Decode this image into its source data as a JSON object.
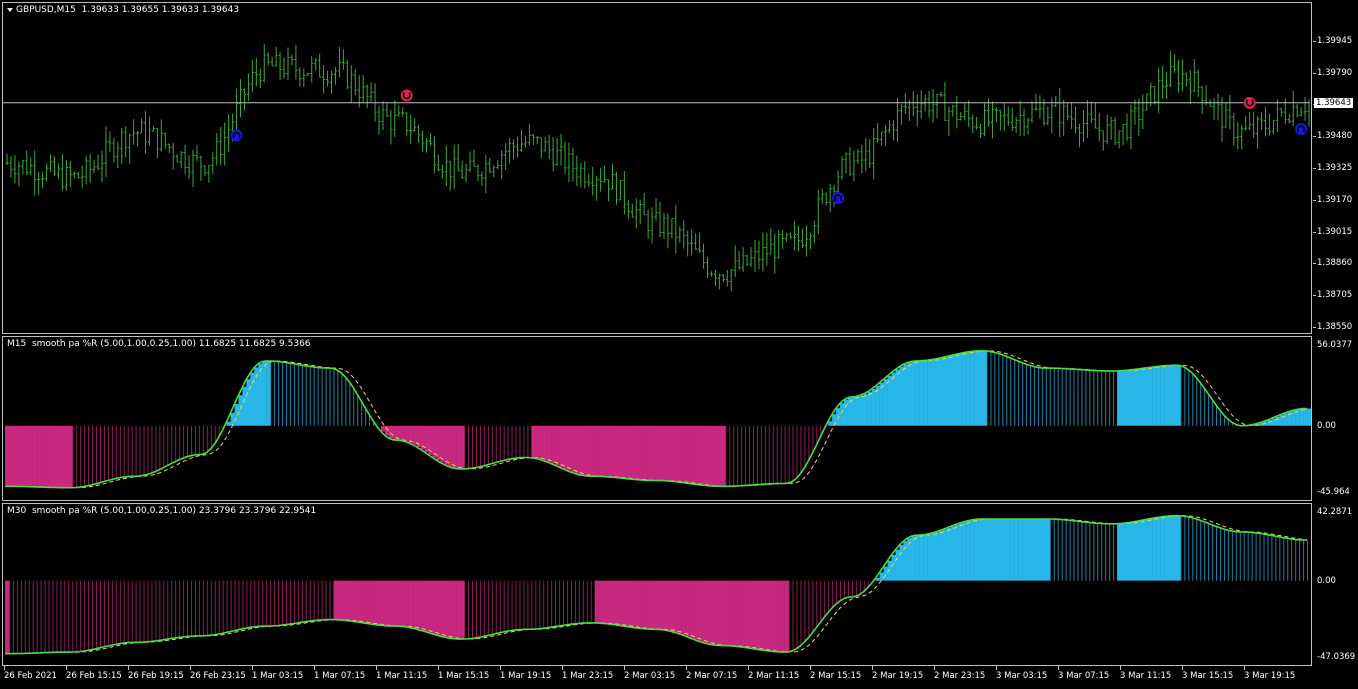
{
  "main": {
    "symbol": "GBPUSD,M15",
    "ohlc": "1.39633 1.39655 1.39633 1.39643",
    "price_labels": [
      "1.39945",
      "1.39790",
      "1.39635",
      "1.39480",
      "1.39325",
      "1.39170",
      "1.39015",
      "1.38860",
      "1.38705",
      "1.38550"
    ],
    "current_price": "1.39643",
    "colors": {
      "bars": "#3ea83e",
      "up_arrow": "#1616e6",
      "down_arrow": "#e0204a",
      "price_line": "#c0c0c0"
    }
  },
  "ind1": {
    "title": "M15  smooth pa %R (5.00,1.00,0.25,1.00) 11.6825 11.6825 9.5366",
    "scale": [
      "56.0377",
      "0.00",
      "-45.964"
    ],
    "colors": {
      "pos": "#29b6e8",
      "neg": "#c8287f",
      "line": "#46e046",
      "signal": "#e8e040"
    }
  },
  "ind2": {
    "title": "M30  smooth pa %R (5.00,1.00,0.25,1.00) 23.3796 23.3796 22.9541",
    "scale": [
      "42.2871",
      "0.00",
      "-47.0369"
    ],
    "colors": {
      "pos": "#29b6e8",
      "neg": "#c8287f",
      "line": "#46e046",
      "signal": "#e8e040"
    }
  },
  "time_axis": [
    "26 Feb 2021",
    "26 Feb 15:15",
    "26 Feb 19:15",
    "26 Feb 23:15",
    "1 Mar 03:15",
    "1 Mar 07:15",
    "1 Mar 11:15",
    "1 Mar 15:15",
    "1 Mar 19:15",
    "1 Mar 23:15",
    "2 Mar 03:15",
    "2 Mar 07:15",
    "2 Mar 11:15",
    "2 Mar 15:15",
    "2 Mar 19:15",
    "2 Mar 23:15",
    "3 Mar 03:15",
    "3 Mar 07:15",
    "3 Mar 11:15",
    "3 Mar 15:15",
    "3 Mar 19:15"
  ],
  "chart_data": [
    {
      "type": "line",
      "title": "GBPUSD,M15",
      "ylim": [
        1.3855,
        1.401
      ],
      "x": [
        "26 Feb 2021",
        "26 Feb 15:15",
        "26 Feb 19:15",
        "26 Feb 23:15",
        "1 Mar 03:15",
        "1 Mar 07:15",
        "1 Mar 11:15",
        "1 Mar 15:15",
        "1 Mar 19:15",
        "1 Mar 23:15",
        "2 Mar 03:15",
        "2 Mar 07:15",
        "2 Mar 11:15",
        "2 Mar 15:15",
        "2 Mar 19:15",
        "2 Mar 23:15",
        "3 Mar 03:15",
        "3 Mar 07:15",
        "3 Mar 11:15",
        "3 Mar 15:15",
        "3 Mar 19:15"
      ],
      "series": [
        {
          "values": [
            1.3935,
            1.3928,
            1.395,
            1.3935,
            1.3982,
            1.398,
            1.3955,
            1.393,
            1.3945,
            1.393,
            1.3905,
            1.3882,
            1.3895,
            1.3935,
            1.3965,
            1.3955,
            1.396,
            1.395,
            1.3978,
            1.395,
            1.3964
          ]
        }
      ]
    },
    {
      "type": "bar",
      "title": "M15  smooth pa %R",
      "ylim": [
        -45.964,
        56.0377
      ],
      "x": [
        "26 Feb 2021",
        "26 Feb 15:15",
        "26 Feb 19:15",
        "26 Feb 23:15",
        "1 Mar 03:15",
        "1 Mar 07:15",
        "1 Mar 11:15",
        "1 Mar 15:15",
        "1 Mar 19:15",
        "1 Mar 23:15",
        "2 Mar 03:15",
        "2 Mar 07:15",
        "2 Mar 11:15",
        "2 Mar 15:15",
        "2 Mar 19:15",
        "2 Mar 23:15",
        "3 Mar 03:15",
        "3 Mar 07:15",
        "3 Mar 11:15",
        "3 Mar 15:15",
        "3 Mar 19:15"
      ],
      "series": [
        {
          "values": [
            -42,
            -43,
            -35,
            -20,
            45,
            40,
            -10,
            -30,
            -22,
            -35,
            -38,
            -42,
            -40,
            20,
            45,
            52,
            40,
            38,
            42,
            0,
            12
          ]
        }
      ]
    },
    {
      "type": "bar",
      "title": "M30  smooth pa %R",
      "ylim": [
        -47.0369,
        42.2871
      ],
      "x": [
        "26 Feb 2021",
        "26 Feb 15:15",
        "26 Feb 19:15",
        "26 Feb 23:15",
        "1 Mar 03:15",
        "1 Mar 07:15",
        "1 Mar 11:15",
        "1 Mar 15:15",
        "1 Mar 19:15",
        "1 Mar 23:15",
        "2 Mar 03:15",
        "2 Mar 07:15",
        "2 Mar 11:15",
        "2 Mar 15:15",
        "2 Mar 19:15",
        "2 Mar 23:15",
        "3 Mar 03:15",
        "3 Mar 07:15",
        "3 Mar 11:15",
        "3 Mar 15:15",
        "3 Mar 19:15"
      ],
      "series": [
        {
          "values": [
            -45,
            -44,
            -38,
            -34,
            -28,
            -24,
            -28,
            -36,
            -30,
            -26,
            -30,
            -40,
            -44,
            -10,
            28,
            38,
            38,
            35,
            40,
            30,
            25
          ]
        }
      ]
    }
  ]
}
